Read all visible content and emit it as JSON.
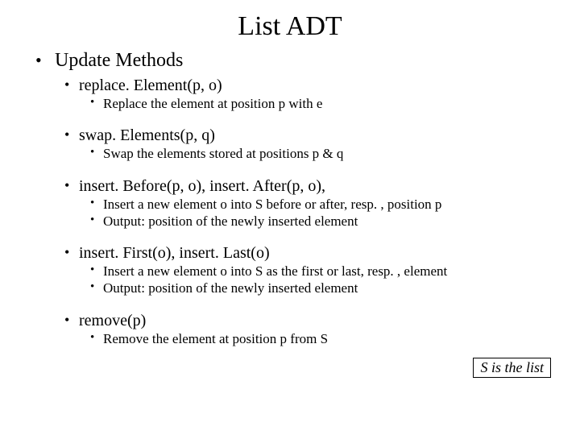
{
  "title": "List ADT",
  "heading": "Update Methods",
  "methods": [
    {
      "name": "replace. Element(p, o)",
      "details": [
        "Replace the element at position p with e"
      ]
    },
    {
      "name": "swap. Elements(p, q)",
      "details": [
        "Swap the elements stored at positions p & q"
      ]
    },
    {
      "name": "insert. Before(p, o), insert. After(p, o),",
      "details": [
        "Insert a new element o into S before or after, resp. , position p",
        "Output: position of the newly inserted element"
      ]
    },
    {
      "name": "insert. First(o), insert. Last(o)",
      "details": [
        "Insert a new element o into S as the first or last, resp. , element",
        "Output: position of the newly inserted element"
      ]
    },
    {
      "name": "remove(p)",
      "details": [
        "Remove the element at position p from S"
      ]
    }
  ],
  "note": "S is the list"
}
